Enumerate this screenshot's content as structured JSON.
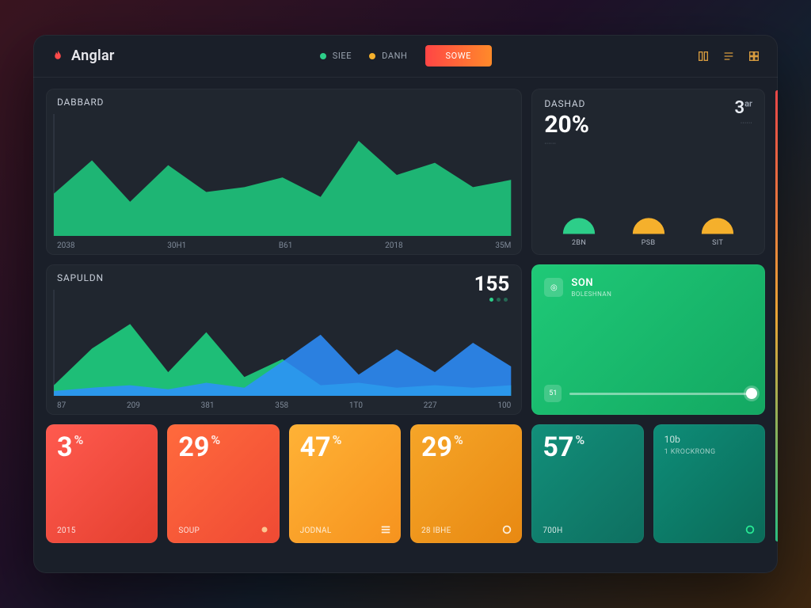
{
  "brand": {
    "name": "Anglar"
  },
  "nav": {
    "items": [
      {
        "label": "SIEE",
        "dot": "#2dce89"
      },
      {
        "label": "DANH",
        "dot": "#f5b02c"
      }
    ],
    "tab_label": "SOWE"
  },
  "chart_data": [
    {
      "id": "dabbard",
      "type": "area",
      "title": "DABBARD",
      "categories": [
        "2038",
        "30H1",
        "B61",
        "2018",
        "35M"
      ],
      "ylim": [
        0,
        100
      ],
      "series": [
        {
          "name": "a",
          "color": "#1ecf80",
          "values": [
            35,
            62,
            28,
            58,
            36,
            40,
            48,
            32,
            78,
            50,
            60,
            40,
            46
          ]
        }
      ]
    },
    {
      "id": "sapuldn",
      "type": "area",
      "title": "SAPULDN",
      "display_value": "155",
      "categories": [
        "87",
        "209",
        "381",
        "358",
        "1T0",
        "227",
        "100"
      ],
      "ylim": [
        0,
        100
      ],
      "series": [
        {
          "name": "green",
          "color": "#1ecf80",
          "values": [
            10,
            45,
            68,
            22,
            60,
            18,
            35,
            10,
            12,
            8,
            10,
            8,
            10
          ]
        },
        {
          "name": "blue",
          "color": "#2e91ff",
          "values": [
            5,
            8,
            10,
            6,
            12,
            8,
            32,
            58,
            20,
            44,
            22,
            50,
            28
          ]
        }
      ]
    }
  ],
  "dashad": {
    "title": "DASHAD",
    "percent": "20%",
    "side_value": "3",
    "side_unit": "ar",
    "mini1": "······",
    "mini2": "······",
    "gauges": [
      {
        "label": "2BN",
        "color": "#2dce89"
      },
      {
        "label": "PSB",
        "color": "#f5b02c"
      },
      {
        "label": "SIT",
        "color": "#f5b02c"
      }
    ]
  },
  "son": {
    "title": "SON",
    "subtitle": "BOLESHNAN",
    "slider_label": "51"
  },
  "stats": [
    {
      "value": "3",
      "pct": true,
      "sub": "2015",
      "skin": "s-red1",
      "icon": ""
    },
    {
      "value": "29",
      "pct": true,
      "sub": "SOUP",
      "skin": "s-red2",
      "icon": "dot"
    },
    {
      "value": "47",
      "pct": true,
      "sub": "JODNAL",
      "skin": "s-orange1",
      "icon": "menu"
    },
    {
      "value": "29",
      "pct": true,
      "sub": "28 IBHE",
      "skin": "s-orange2",
      "icon": "ring"
    },
    {
      "value": "57",
      "pct": true,
      "sub": "700H",
      "skin": "s-teal",
      "icon": "",
      "extra_top": "10b",
      "extra_mid": "1 KROCKRONG"
    },
    {
      "value": "",
      "pct": false,
      "sub": "",
      "skin": "s-teal2",
      "icon": "ring-green",
      "content_top": "10b",
      "content_mid": "1 KROCKRONG"
    }
  ]
}
